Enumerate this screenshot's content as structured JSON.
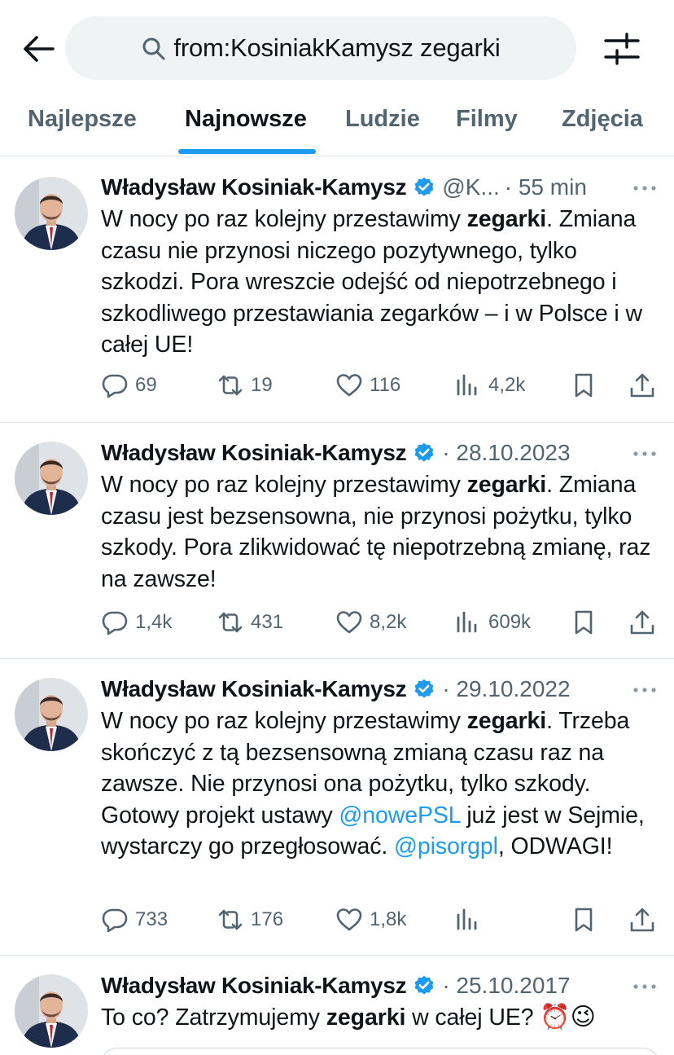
{
  "search": {
    "query": "from:KosiniakKamysz zegarki"
  },
  "tabs": [
    {
      "label": "Najlepsze"
    },
    {
      "label": "Najnowsze"
    },
    {
      "label": "Ludzie"
    },
    {
      "label": "Filmy"
    },
    {
      "label": "Zdjęcia"
    }
  ],
  "active_tab": "Najnowsze",
  "accent_color": "#1d9bf0",
  "tweets": [
    {
      "author": "Władysław Kosiniak-Kamysz",
      "handle": "@K...",
      "time": "· 55 min",
      "text_parts": [
        "W nocy po raz kolejny przestawimy ",
        "zegarki",
        ". Zmiana czasu nie przynosi niczego pozytywnego, tylko szkodzi. Pora wreszcie odejść od niepotrzebnego i szkodliwego przestawiania zegarków – i w Polsce i w całej UE!"
      ],
      "replies": "69",
      "retweets": "19",
      "likes": "116",
      "views": "4,2k"
    },
    {
      "author": "Władysław Kosiniak-Kamysz",
      "time": "· 28.10.2023",
      "text_parts": [
        "W nocy po raz kolejny przestawimy ",
        "zegarki",
        ". Zmiana czasu jest bezsensowna, nie przynosi pożytku, tylko szkody. Pora zlikwidować tę niepotrzebną zmianę, raz na zawsze!"
      ],
      "replies": "1,4k",
      "retweets": "431",
      "likes": "8,2k",
      "views": "609k"
    },
    {
      "author": "Władysław Kosiniak-Kamysz",
      "time": "· 29.10.2022",
      "text_parts": [
        "W nocy po raz kolejny przestawimy ",
        "zegarki",
        ". Trzeba skończyć z tą bezsensowną zmianą czasu raz na zawsze. Nie przynosi ona pożytku, tylko szkody. Gotowy projekt ustawy ",
        "@nowePSL",
        " już jest w Sejmie, wystarczy go przegłosować. ",
        "@pisorgpl",
        ", ODWAGI!"
      ],
      "replies": "733",
      "retweets": "176",
      "likes": "1,8k",
      "views": ""
    },
    {
      "author": "Władysław Kosiniak-Kamysz",
      "time": "· 25.10.2017",
      "text_parts": [
        "To co? Zatrzymujemy ",
        "zegarki",
        " w całej UE? ",
        "⏰",
        "😉"
      ]
    }
  ]
}
